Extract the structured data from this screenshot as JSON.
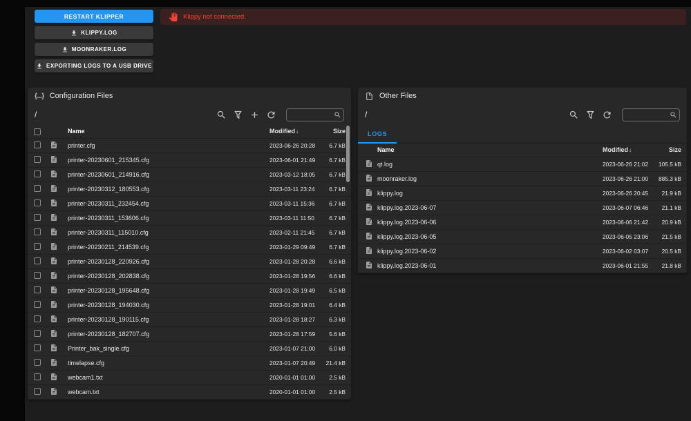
{
  "colors": {
    "accent": "#2196f3",
    "error": "#f44336"
  },
  "machine_actions": {
    "restart_klipper": "RESTART KLIPPER",
    "klippy_log": "KLIPPY.LOG",
    "moonraker_log": "MOONRAKER.LOG",
    "export_usb": "EXPORTING LOGS TO A USB DRIVE"
  },
  "alert": {
    "message": "Klippy not connected."
  },
  "config_panel": {
    "icon_glyph": "{...}",
    "title": "Configuration Files",
    "path": "/",
    "columns": {
      "name": "Name",
      "modified": "Modified",
      "size": "Size"
    },
    "sort_arrow": "↓",
    "files": [
      {
        "name": "printer.cfg",
        "modified": "2023-06-26 20:28",
        "size": "6.7 kB"
      },
      {
        "name": "printer-20230601_215345.cfg",
        "modified": "2023-06-01 21:49",
        "size": "6.7 kB"
      },
      {
        "name": "printer-20230601_214916.cfg",
        "modified": "2023-03-12 18:05",
        "size": "6.7 kB"
      },
      {
        "name": "printer-20230312_180553.cfg",
        "modified": "2023-03-11 23:24",
        "size": "6.7 kB"
      },
      {
        "name": "printer-20230311_232454.cfg",
        "modified": "2023-03-11 15:36",
        "size": "6.7 kB"
      },
      {
        "name": "printer-20230311_153606.cfg",
        "modified": "2023-03-11 11:50",
        "size": "6.7 kB"
      },
      {
        "name": "printer-20230311_115010.cfg",
        "modified": "2023-02-11 21:45",
        "size": "6.7 kB"
      },
      {
        "name": "printer-20230211_214539.cfg",
        "modified": "2023-01-29 09:49",
        "size": "6.7 kB"
      },
      {
        "name": "printer-20230128_220926.cfg",
        "modified": "2023-01-28 20:28",
        "size": "6.6 kB"
      },
      {
        "name": "printer-20230128_202838.cfg",
        "modified": "2023-01-28 19:56",
        "size": "6.6 kB"
      },
      {
        "name": "printer-20230128_195648.cfg",
        "modified": "2023-01-28 19:49",
        "size": "6.5 kB"
      },
      {
        "name": "printer-20230128_194030.cfg",
        "modified": "2023-01-28 19:01",
        "size": "6.4 kB"
      },
      {
        "name": "printer-20230128_190115.cfg",
        "modified": "2023-01-28 18:27",
        "size": "6.3 kB"
      },
      {
        "name": "printer-20230128_182707.cfg",
        "modified": "2023-01-28 17:59",
        "size": "5.6 kB"
      },
      {
        "name": "Printer_bak_single.cfg",
        "modified": "2023-01-07 21:00",
        "size": "6.0 kB"
      },
      {
        "name": "timelapse.cfg",
        "modified": "2023-01-07 20:49",
        "size": "21.4 kB"
      },
      {
        "name": "webcam1.txt",
        "modified": "2020-01-01 01:00",
        "size": "2.5 kB"
      },
      {
        "name": "webcam.txt",
        "modified": "2020-01-01 01:00",
        "size": "2.5 kB"
      }
    ]
  },
  "other_panel": {
    "title": "Other Files",
    "path": "/",
    "tabs": [
      {
        "label": "LOGS",
        "active": true
      }
    ],
    "columns": {
      "name": "Name",
      "modified": "Modified",
      "size": "Size"
    },
    "sort_arrow": "↓",
    "files": [
      {
        "name": "qt.log",
        "modified": "2023-06-26 21:02",
        "size": "105.5 kB"
      },
      {
        "name": "moonraker.log",
        "modified": "2023-06-26 21:00",
        "size": "885.3 kB"
      },
      {
        "name": "klippy.log",
        "modified": "2023-06-26 20:45",
        "size": "21.9 kB"
      },
      {
        "name": "klippy.log.2023-06-07",
        "modified": "2023-06-07 06:46",
        "size": "21.1 kB"
      },
      {
        "name": "klippy.log.2023-06-06",
        "modified": "2023-06-06 21:42",
        "size": "20.9 kB"
      },
      {
        "name": "klippy.log.2023-06-05",
        "modified": "2023-06-05 23:06",
        "size": "21.5 kB"
      },
      {
        "name": "klippy.log.2023-06-02",
        "modified": "2023-06-02 03:07",
        "size": "20.5 kB"
      },
      {
        "name": "klippy.log.2023-06-01",
        "modified": "2023-06-01 21:55",
        "size": "21.8 kB"
      }
    ]
  }
}
